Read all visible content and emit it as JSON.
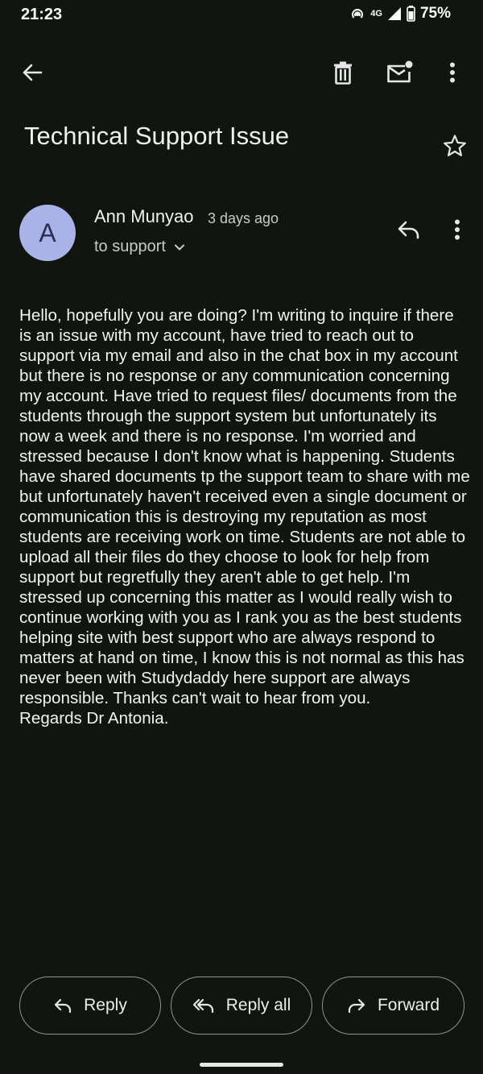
{
  "status_bar": {
    "time": "21:23",
    "network": "4G",
    "battery": "75%"
  },
  "toolbar": {
    "back_icon": "arrow-back-icon",
    "delete_icon": "trash-icon",
    "mark_unread_icon": "mail-unread-icon",
    "more_icon": "more-vert-icon"
  },
  "email": {
    "subject": "Technical Support Issue",
    "avatar_initial": "A",
    "avatar_color": "#aab3e8",
    "sender": "Ann Munyao",
    "time": "3 days ago",
    "recipient": "to support",
    "body": "Hello, hopefully you are doing? I'm writing to inquire if there is an issue with my account, have tried to reach out to support via my email and also in the chat box in my account but there is no response or any communication concerning my account. Have tried to request files/ documents from the students through the support system but unfortunately its now a week and there is no response. I'm worried and stressed because I don't know what is happening. Students have shared documents tp the support team to share with me but unfortunately haven't received even a single document or communication this is destroying my reputation as most students are receiving work on time. Students are not able to upload all their files do they choose to look for help from support but regretfully they aren't able to get help. I'm stressed up concerning this matter as I would really wish to continue working with you as I rank you as the best students helping site with best support who are always respond to matters at hand on time, I know this is not normal as this has never been with Studydaddy here support are always responsible. Thanks can't wait to hear from you.\nRegards Dr Antonia."
  },
  "actions": {
    "reply": "Reply",
    "reply_all": "Reply all",
    "forward": "Forward"
  },
  "colors": {
    "background": "#111510",
    "text": "#f3f3f3",
    "outline": "#8e918c"
  }
}
